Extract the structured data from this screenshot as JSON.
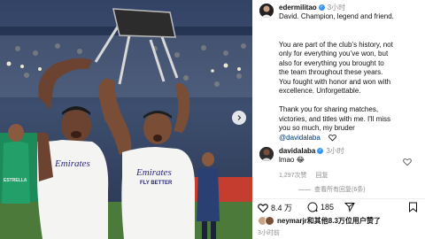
{
  "post": {
    "author": "edermilitao",
    "time": "3小时",
    "caption_lines": [
      "David. Champion, legend and friend.",
      "",
      "You are part of the club’s history, not",
      "only for everything you’ve won, but",
      "also for everything you brought to",
      "the team throughout these years.",
      "You fought with honor and won with",
      "excellence. Unforgettable.",
      "",
      "Thank you for sharing matches,",
      "victories, and titles with me. I'll miss",
      "you so much, my bruder"
    ],
    "mention": "@davidalaba"
  },
  "photo": {
    "jersey_text_left": "Emirates",
    "jersey_text_right": "Emirates",
    "jersey_subtext_right": "FLY BETTER",
    "side_sign": "ESTRELLA"
  },
  "comment": {
    "author": "davidalaba",
    "time": "3小时",
    "text": "lmao",
    "likes": "1,297次赞",
    "reply_label": "回复",
    "view_replies": "查看所有回复(6条)"
  },
  "actions": {
    "likes": "8.4 万",
    "comments": "185"
  },
  "likes_summary": "neymarjr和其他8.3万位用户赞了",
  "footer_time": "3小时前",
  "colors": {
    "verified": "#3897f0",
    "heart_red": "#ed4956",
    "jersey": "#f4f4f2"
  }
}
